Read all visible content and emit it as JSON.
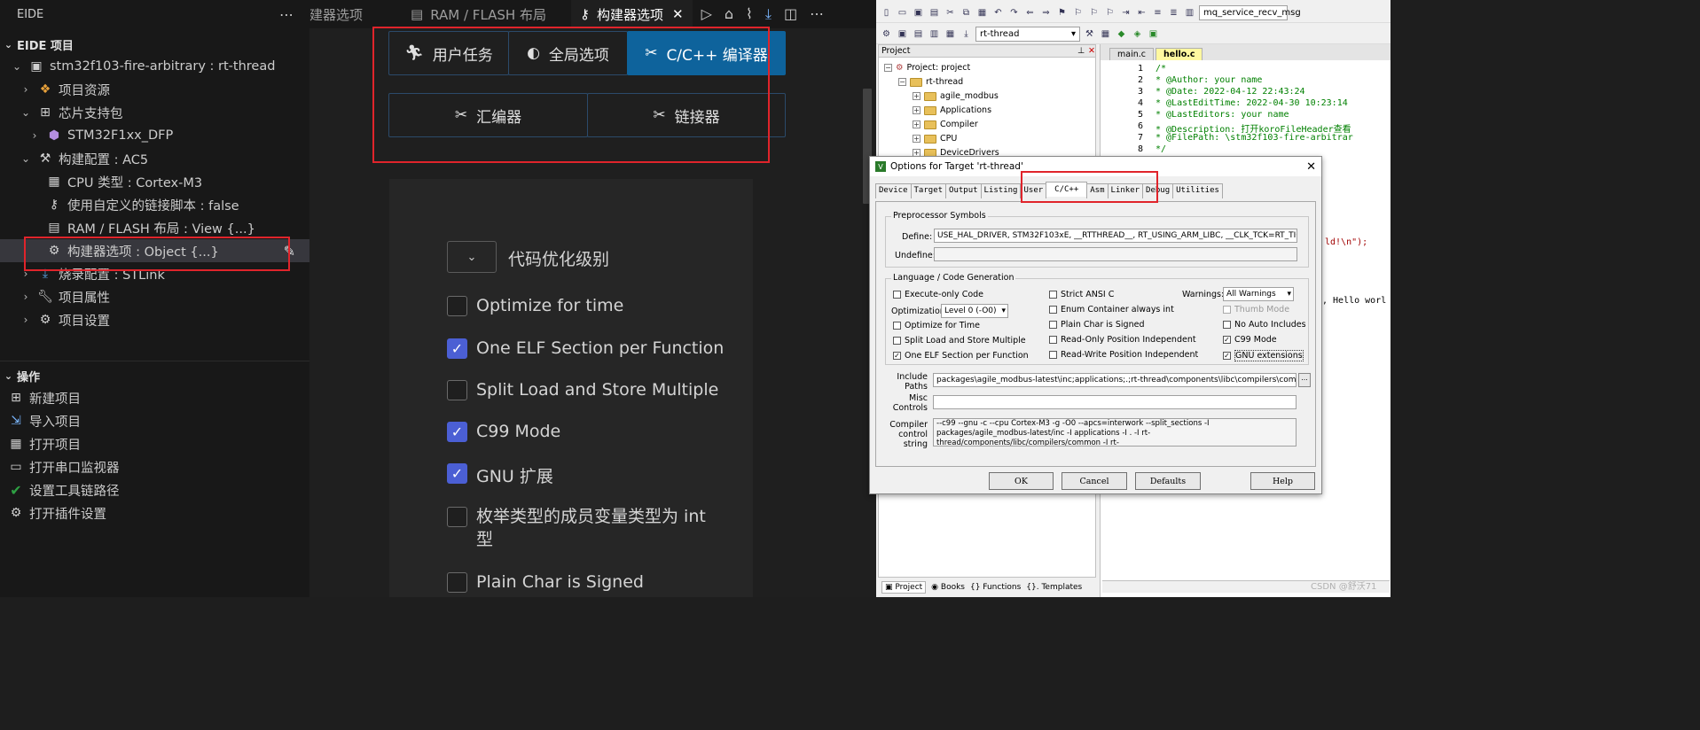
{
  "sidebar": {
    "header": "EIDE",
    "section_project": "EIDE 项目",
    "tree": [
      {
        "label": "stm32f103-fire-arbitrary : rt-thread",
        "icon": "chip-board-icon"
      },
      {
        "label": "项目资源",
        "icon": "resources-icon"
      },
      {
        "label": "芯片支持包",
        "icon": "package-icon"
      },
      {
        "label": "STM32F1xx_DFP",
        "icon": "cube-icon"
      },
      {
        "label": "构建配置 : AC5",
        "icon": "hammer-icon"
      },
      {
        "label": "CPU 类型 : Cortex-M3",
        "icon": "cpu-icon"
      },
      {
        "label": "使用自定义的链接脚本 : false",
        "icon": "key-icon"
      },
      {
        "label": "RAM / FLASH 布局 : View {...}",
        "icon": "memory-icon"
      },
      {
        "label": "构建器选项 : Object {...}",
        "icon": "builder-icon"
      },
      {
        "label": "烧录配置 : STLink",
        "icon": "download-icon"
      },
      {
        "label": "项目属性",
        "icon": "wrench-icon"
      },
      {
        "label": "项目设置",
        "icon": "settings-icon"
      }
    ],
    "section_ops": "操作",
    "ops": [
      {
        "label": "新建项目",
        "icon": "new-project-icon"
      },
      {
        "label": "导入项目",
        "icon": "import-icon"
      },
      {
        "label": "打开项目",
        "icon": "open-project-icon"
      },
      {
        "label": "打开串口监视器",
        "icon": "serial-icon"
      },
      {
        "label": "设置工具链路径",
        "icon": "check-circle-icon"
      },
      {
        "label": "打开插件设置",
        "icon": "gear-icon"
      }
    ]
  },
  "editor_tabs": {
    "tab1": "建器选项",
    "tab2": "RAM / FLASH 布局",
    "tab3": "构建器选项"
  },
  "builder": {
    "tabs_row1": [
      "用户任务",
      "全局选项",
      "C/C++ 编译器"
    ],
    "tabs_row2": [
      "汇编器",
      "链接器"
    ],
    "optimization_label": "代码优化级别",
    "options": [
      {
        "label": "Optimize for time",
        "checked": false
      },
      {
        "label": "One ELF Section per Function",
        "checked": true
      },
      {
        "label": "Split Load and Store Multiple",
        "checked": false
      },
      {
        "label": "C99 Mode",
        "checked": true
      },
      {
        "label": "GNU 扩展",
        "checked": true
      },
      {
        "label": "枚举类型的成员变量类型为 int 型",
        "checked": false
      },
      {
        "label": "Plain Char is Signed",
        "checked": false
      }
    ]
  },
  "keil": {
    "toolbar_combo1": "mq_service_recv_msg",
    "toolbar_combo2": "rt-thread",
    "project_panel_title": "Project",
    "project_tree": [
      "Project: project",
      "rt-thread",
      "agile_modbus",
      "Applications",
      "Compiler",
      "CPU",
      "DeviceDrivers"
    ],
    "project_tabs": [
      "Project",
      "Books",
      "{} Functions",
      "{}. Templates"
    ],
    "editor_tabs": [
      "main.c",
      "hello.c"
    ],
    "code_lines": [
      {
        "n": "1",
        "text": "/*"
      },
      {
        "n": "2",
        "text": " * @Author: your name"
      },
      {
        "n": "3",
        "text": " * @Date: 2022-04-12 22:43:24"
      },
      {
        "n": "4",
        "text": " * @LastEditTime: 2022-04-30 10:23:14"
      },
      {
        "n": "5",
        "text": " * @LastEditors: your name"
      },
      {
        "n": "6",
        "text": " * @Description: 打开koroFileHeader查看"
      },
      {
        "n": "7",
        "text": " * @FilePath: \\stm32f103-fire-arbitrar"
      },
      {
        "n": "8",
        "text": " */"
      }
    ],
    "code_frag1": "ld!\\n\");",
    "code_frag2": ", Hello worl",
    "watermark": "CSDN @舒沃71"
  },
  "dialog": {
    "title": "Options for Target 'rt-thread'",
    "tabs": [
      "Device",
      "Target",
      "Output",
      "Listing",
      "User",
      "C/C++",
      "Asm",
      "Linker",
      "Debug",
      "Utilities"
    ],
    "pre_title": "Preprocessor Symbols",
    "define_label": "Define:",
    "define_value": "USE_HAL_DRIVER, STM32F103xE, __RTTHREAD__, RT_USING_ARM_LIBC, __CLK_TCK=RT_TICK",
    "undefine_label": "Undefine:",
    "lang_title": "Language / Code Generation",
    "col1": [
      "Execute-only Code",
      "Optimize for Time",
      "Split Load and Store Multiple",
      "One ELF Section per Function"
    ],
    "col1_checked": [
      false,
      false,
      false,
      true
    ],
    "optimization_label": "Optimization:",
    "optimization_value": "Level 0 (-O0)",
    "col2": [
      "Strict ANSI C",
      "Enum Container always int",
      "Plain Char is Signed",
      "Read-Only Position Independent",
      "Read-Write Position Independent"
    ],
    "warnings_label": "Warnings:",
    "warnings_value": "All Warnings",
    "col3": [
      "Thumb Mode",
      "No Auto Includes",
      "C99 Mode",
      "GNU extensions"
    ],
    "col3_checked": [
      false,
      false,
      true,
      true
    ],
    "include_label": "Include Paths",
    "include_value": "packages\\agile_modbus-latest\\inc;applications;.;rt-thread\\components\\libc\\compilers\\common;rt-thre",
    "misc_label": "Misc Controls",
    "ccs_label": "Compiler control string",
    "ccs_value": "--c99 --gnu -c --cpu Cortex-M3 -g -O0 --apcs=interwork --split_sections -I packages/agile_modbus-latest/inc -I applications -I . -I rt-thread/components/libc/compilers/common -I rt-",
    "buttons": [
      "OK",
      "Cancel",
      "Defaults",
      "Help"
    ]
  }
}
